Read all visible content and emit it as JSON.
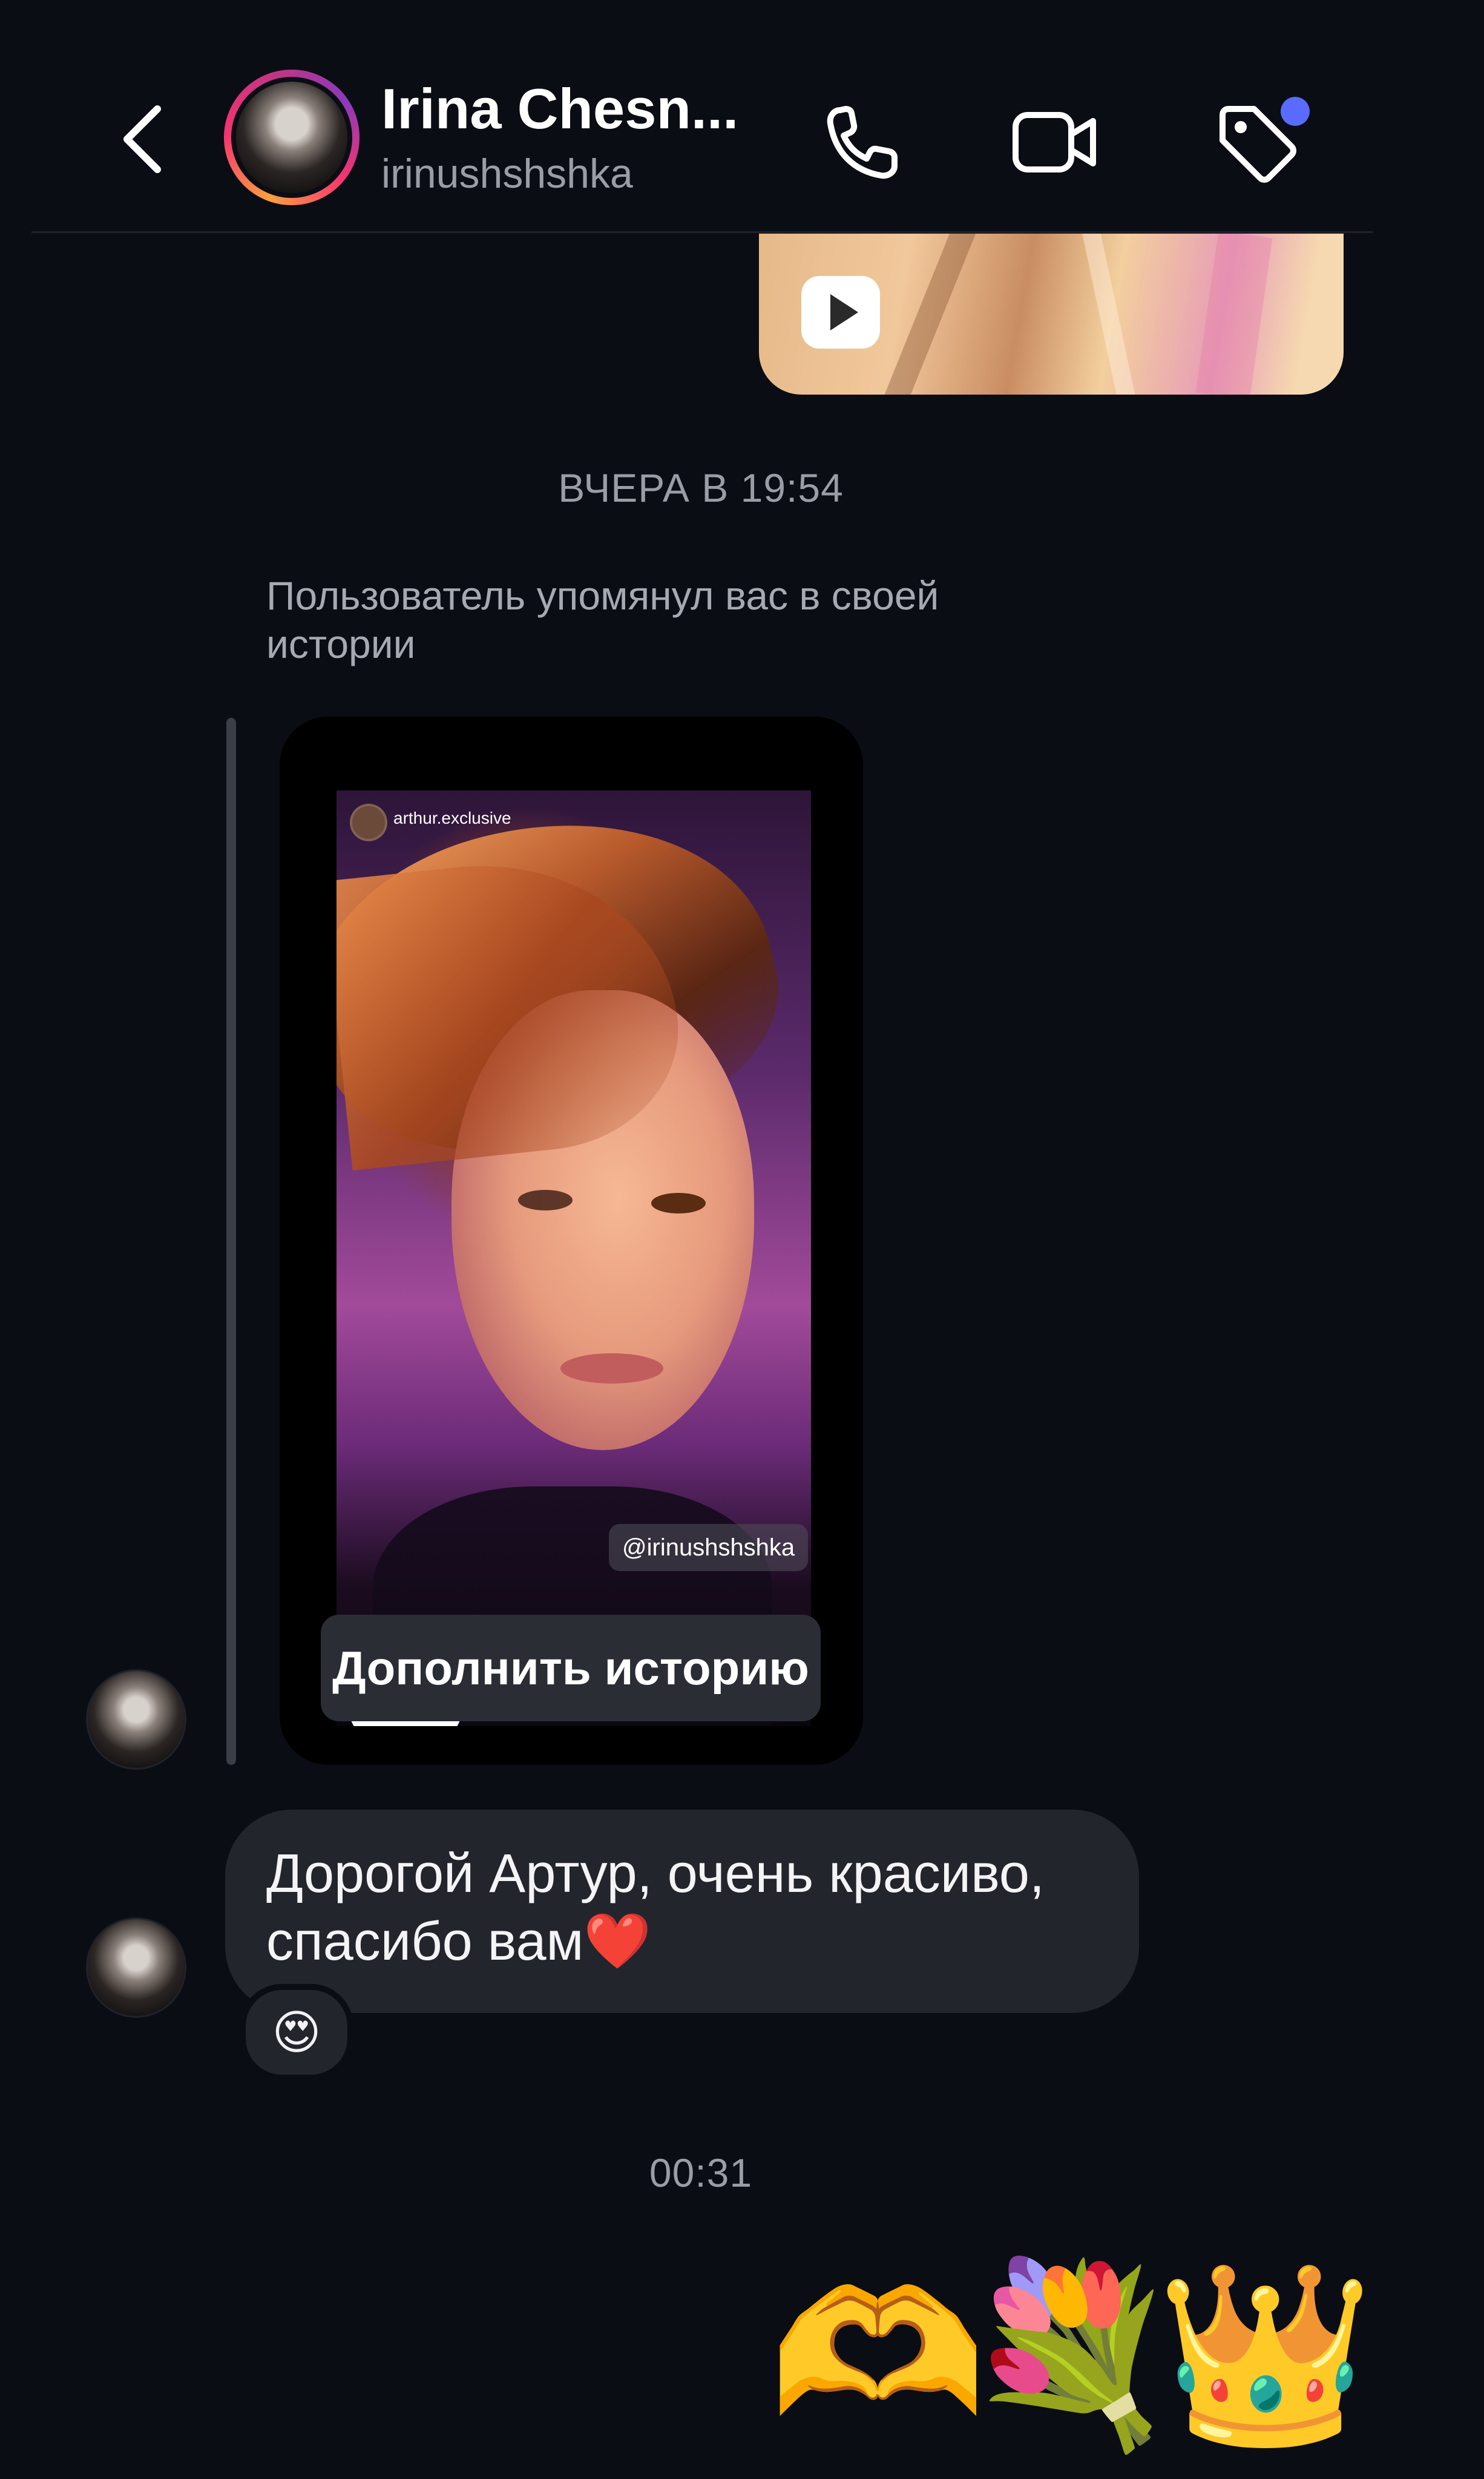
{
  "header": {
    "name": "Irina Chesn...",
    "username": "irinushshshka",
    "back_icon": "chevron-left-icon",
    "call_icon": "phone-icon",
    "video_icon": "video-camera-icon",
    "tag_icon": "tag-icon"
  },
  "messages": {
    "prev_media_play_icon": "play-icon",
    "timestamp_yesterday": "ВЧЕРА В 19:54",
    "mention_note": "Пользователь упомянул вас в своей истории",
    "story": {
      "author": "arthur.exclusive",
      "mention_tag": "@irinushshshka",
      "sticker_emoji": "😌",
      "button_label": "Дополнить историю"
    },
    "reply_text": "Дорогой Артур, очень красиво, спасибо вам❤️",
    "reaction": "😍",
    "timestamp_late": "00:31",
    "emoji_message": [
      "🫶",
      "💐",
      "👑"
    ]
  },
  "colors": {
    "background": "#0b0d14",
    "bubble": "#23252c",
    "accent_dot": "#5a6bff",
    "muted_text": "#9a9ca6"
  }
}
